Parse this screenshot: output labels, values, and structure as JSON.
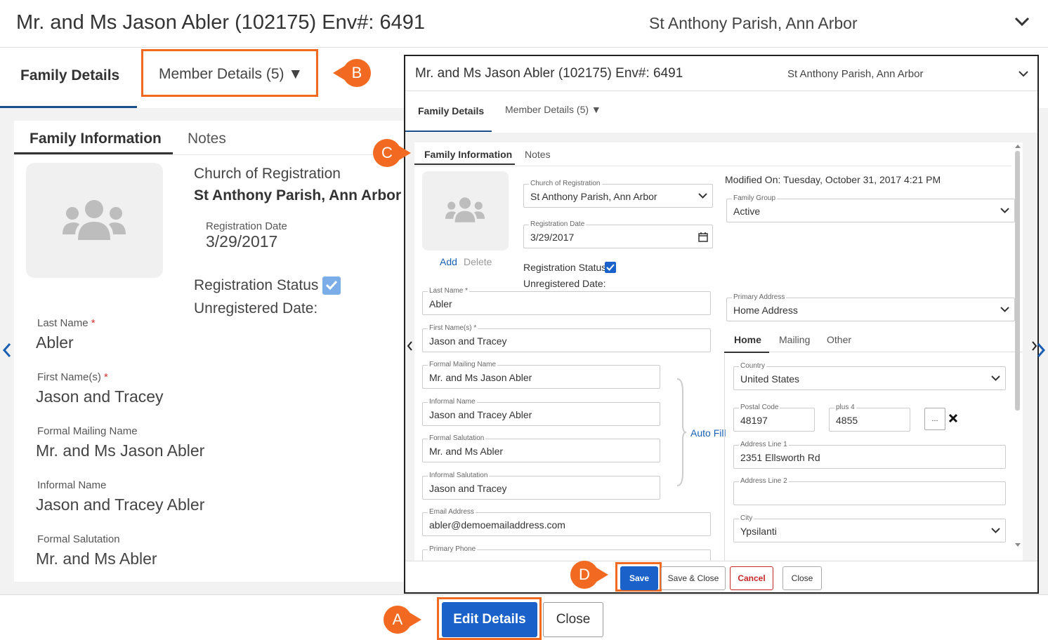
{
  "header": {
    "title": "Mr. and Ms Jason Abler (102175) Env#: 6491",
    "parish": "St Anthony Parish, Ann Arbor"
  },
  "tabs": {
    "family_details": "Family Details",
    "member_details": "Member Details (5)  ▼"
  },
  "callouts": {
    "a": "A",
    "b": "B",
    "c": "C",
    "d": "D"
  },
  "card": {
    "tab_family_info": "Family Information",
    "tab_notes": "Notes",
    "church_label": "Church of Registration",
    "church_value": "St Anthony Parish, Ann Arbor",
    "reg_date_label": "Registration Date",
    "reg_date_value": "3/29/2017",
    "reg_status_label": "Registration Status",
    "unreg_label": "Unregistered Date:",
    "last_name_label": "Last Name",
    "last_name_value": "Abler",
    "first_name_label": "First Name(s)",
    "first_name_value": "Jason and Tracey",
    "formal_mailing_label": "Formal Mailing Name",
    "formal_mailing_value": "Mr. and Ms Jason Abler",
    "informal_name_label": "Informal Name",
    "informal_name_value": "Jason and Tracey Abler",
    "formal_salutation_label": "Formal Salutation",
    "formal_salutation_value": "Mr. and Ms Abler",
    "required_mark": "*"
  },
  "bottom": {
    "edit_details": "Edit Details",
    "close": "Close"
  },
  "modal": {
    "title": "Mr. and Ms Jason Abler (102175) Env#: 6491",
    "parish": "St Anthony Parish, Ann Arbor",
    "tab_family_details": "Family Details",
    "tab_member_details": "Member Details (5)  ▼",
    "tab_family_info": "Family Information",
    "tab_notes": "Notes",
    "avatar_add": "Add",
    "avatar_delete": "Delete",
    "church_label": "Church of Registration",
    "church_value": "St Anthony Parish, Ann Arbor",
    "reg_date_label": "Registration Date",
    "reg_date_value": "3/29/2017",
    "reg_status_label": "Registration Status",
    "unreg_label": "Unregistered Date:",
    "modified_on": "Modified On: Tuesday, October 31, 2017 4:21 PM",
    "family_group_label": "Family Group",
    "family_group_value": "Active",
    "last_name_label": "Last Name *",
    "last_name_value": "Abler",
    "first_name_label": "First Name(s) *",
    "first_name_value": "Jason and Tracey",
    "formal_mailing_label": "Formal Mailing Name",
    "formal_mailing_value": "Mr. and Ms Jason Abler",
    "informal_name_label": "Informal Name",
    "informal_name_value": "Jason and Tracey Abler",
    "formal_salutation_label": "Formal Salutation",
    "formal_salutation_value": "Mr. and Ms Abler",
    "informal_salutation_label": "Informal Salutation",
    "informal_salutation_value": "Jason and Tracey",
    "email_label": "Email Address",
    "email_value": "abler@demoemailaddress.com",
    "primary_phone_label": "Primary Phone",
    "auto_fill": "Auto Fill",
    "primary_address_label": "Primary Address",
    "primary_address_value": "Home Address",
    "address_tabs": [
      "Home",
      "Mailing",
      "Other"
    ],
    "country_label": "Country",
    "country_value": "United States",
    "postal_label": "Postal Code",
    "postal_value": "48197",
    "plus4_label": "plus 4",
    "plus4_value": "4855",
    "ellipsis": "...",
    "address1_label": "Address Line 1",
    "address1_value": "2351 Ellsworth Rd",
    "address2_label": "Address Line 2",
    "address2_value": "",
    "city_label": "City",
    "city_value": "Ypsilanti",
    "buttons": {
      "save": "Save",
      "save_close": "Save & Close",
      "cancel": "Cancel",
      "close": "Close"
    }
  },
  "colors": {
    "accent_orange": "#f26a21",
    "primary_blue": "#1a62c9",
    "link_blue": "#1a5fb4",
    "cancel_red": "#c62828"
  },
  "icons": [
    "chevron-down-icon",
    "family-group-icon",
    "check-icon",
    "calendar-icon",
    "close-x-icon",
    "chevron-left-icon",
    "chevron-right-icon"
  ]
}
